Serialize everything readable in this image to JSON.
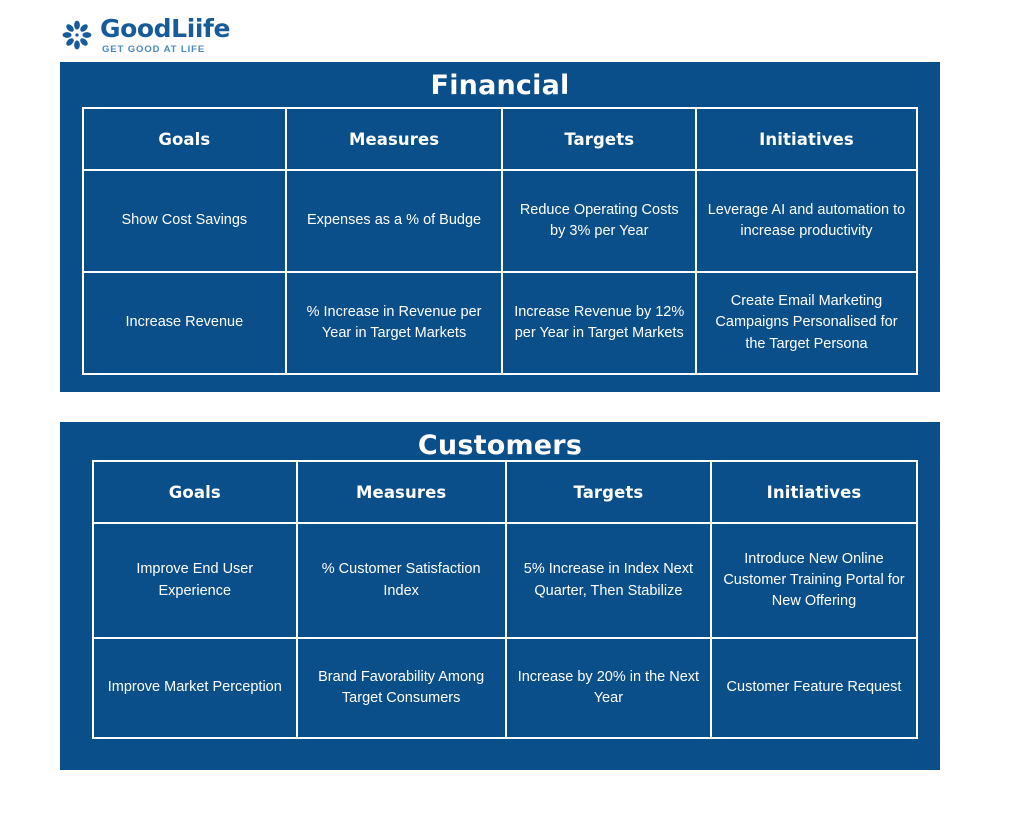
{
  "brand": {
    "icon": "flower-logo-icon",
    "name": "GoodLiife",
    "tagline": "GET GOOD AT LIFE",
    "brand_color": "#175b9c",
    "tagline_color": "#4a89bf"
  },
  "theme": {
    "panel_blue": "#0a4e8a",
    "border_white": "#ffffff",
    "text_white": "#ffffff",
    "page_background": "#ffffff"
  },
  "panels": [
    {
      "id": "financial",
      "title": "Financial",
      "columns": [
        "Goals",
        "Measures",
        "Targets",
        "Initiatives"
      ],
      "rows": [
        {
          "goals": "Show Cost Savings",
          "measures": "Expenses as a % of Budge",
          "targets": "Reduce Operating Costs by 3% per Year",
          "initiatives": "Leverage AI and automation to increase productivity"
        },
        {
          "goals": "Increase Revenue",
          "measures": "% Increase in Revenue per Year in Target Markets",
          "targets": "Increase Revenue by 12% per Year in Target Markets",
          "initiatives": "Create Email Marketing Campaigns Personalised for the Target Persona"
        }
      ]
    },
    {
      "id": "customers",
      "title": "Customers",
      "columns": [
        "Goals",
        "Measures",
        "Targets",
        "Initiatives"
      ],
      "rows": [
        {
          "goals": "Improve End User Experience",
          "measures": "% Customer Satisfaction Index",
          "targets": "5% Increase in Index Next Quarter, Then Stabilize",
          "initiatives": "Introduce New Online Customer Training Portal for New Offering"
        },
        {
          "goals": "Improve Market Perception",
          "measures": "Brand Favorability Among Target Consumers",
          "targets": "Increase by 20% in the Next Year",
          "initiatives": "Customer Feature Request"
        }
      ]
    }
  ]
}
